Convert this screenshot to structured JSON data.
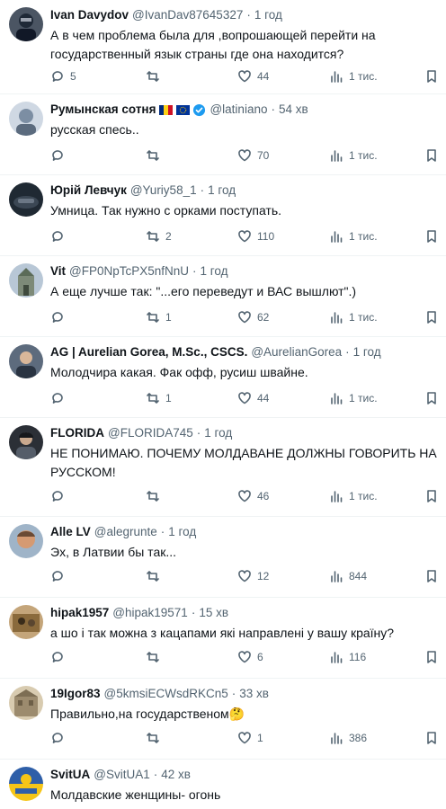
{
  "tweets": [
    {
      "name": "Ivan Davydov",
      "handle": "@IvanDav87645327",
      "time": "1 год",
      "text": "А в чем проблема была для ,вопрошающей перейти на государственный язык страны где она находится?",
      "replies": "5",
      "retweets": "",
      "likes": "44",
      "views": "1 тис.",
      "avatar_color": "#4b5563",
      "flags": false,
      "verified": false
    },
    {
      "name": "Румынская сотня",
      "handle": "@latiniano",
      "time": "54 хв",
      "text": "русская спесь..",
      "replies": "",
      "retweets": "",
      "likes": "70",
      "views": "1 тис.",
      "avatar_color": "#7c8ea3",
      "flags": true,
      "verified": true
    },
    {
      "name": "Юрій Левчук",
      "handle": "@Yuriy58_1",
      "time": "1 год",
      "text": "Умница. Так нужно с орками поступать.",
      "replies": "",
      "retweets": "2",
      "likes": "110",
      "views": "1 тис.",
      "avatar_color": "#1f2933",
      "flags": false,
      "verified": false
    },
    {
      "name": "Vit",
      "handle": "@FP0NpTcPX5nfNnU",
      "time": "1 год",
      "text": "А еще лучше так: \"...его переведут и ВАС вышлют\".)",
      "replies": "",
      "retweets": "1",
      "likes": "62",
      "views": "1 тис.",
      "avatar_color": "#8fa3b8",
      "flags": false,
      "verified": false
    },
    {
      "name": "AG | Aurelian Gorea, M.Sc., CSCS.",
      "handle": "@AurelianGorea",
      "time": "1 год",
      "text": "Молодчира какая. Фак офф, русиш швайне.",
      "replies": "",
      "retweets": "1",
      "likes": "44",
      "views": "1 тис.",
      "avatar_color": "#3d4a5c",
      "flags": false,
      "verified": false
    },
    {
      "name": "FLORIDA",
      "handle": "@FLORIDA745",
      "time": "1 год",
      "text": "НЕ ПОНИМАЮ. ПОЧЕМУ МОЛДАВАНЕ ДОЛЖНЫ ГОВОРИТЬ НА РУССКОМ!",
      "replies": "",
      "retweets": "",
      "likes": "46",
      "views": "1 тис.",
      "avatar_color": "#2b2f36",
      "flags": false,
      "verified": false
    },
    {
      "name": "Alle LV",
      "handle": "@alegrunte",
      "time": "1 год",
      "text": "Эх, в Латвии бы так...",
      "replies": "",
      "retweets": "",
      "likes": "12",
      "views": "844",
      "avatar_color": "#b9714a",
      "flags": false,
      "verified": false
    },
    {
      "name": "hipak1957",
      "handle": "@hipak19571",
      "time": "15 хв",
      "text": "а шо і так можна з кацапами які направлені у вашу країну?",
      "replies": "",
      "retweets": "",
      "likes": "6",
      "views": "116",
      "avatar_color": "#8a6a3c",
      "flags": false,
      "verified": false
    },
    {
      "name": "19Igor83",
      "handle": "@5kmsiECWsdRKCn5",
      "time": "33 хв",
      "text": "Правильно,на государственом🤔",
      "replies": "",
      "retweets": "",
      "likes": "1",
      "views": "386",
      "avatar_color": "#9c8b6e",
      "flags": false,
      "verified": false
    },
    {
      "name": "SvitUA",
      "handle": "@SvitUA1",
      "time": "42 хв",
      "text": "Молдавские женщины- огонь",
      "replies": "",
      "retweets": "",
      "likes": "",
      "views": "",
      "avatar_color": "#2f5fa8",
      "flags": false,
      "verified": false
    }
  ]
}
